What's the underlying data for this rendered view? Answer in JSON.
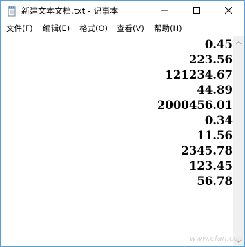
{
  "window": {
    "title": "新建文本文档.txt - 记事本",
    "icon": "notepad-icon",
    "accent_color": "#5a9fd4"
  },
  "controls": {
    "minimize_icon": "minimize-icon",
    "maximize_icon": "maximize-icon",
    "close_icon": "close-icon"
  },
  "menu": {
    "items": [
      {
        "label": "文件(F)"
      },
      {
        "label": "编辑(E)"
      },
      {
        "label": "格式(O)"
      },
      {
        "label": "查看(V)"
      },
      {
        "label": "帮助(H)"
      }
    ]
  },
  "editor": {
    "lines": [
      "0.45",
      "223.56",
      "121234.67",
      "44.89",
      "2000456.01",
      "0.34",
      "11.56",
      "2345.78",
      "123.45",
      "56.78"
    ],
    "alignment": "right"
  },
  "scrollbar": {
    "up_icon": "scroll-up-arrow-icon",
    "down_icon": "scroll-down-arrow-icon"
  }
}
